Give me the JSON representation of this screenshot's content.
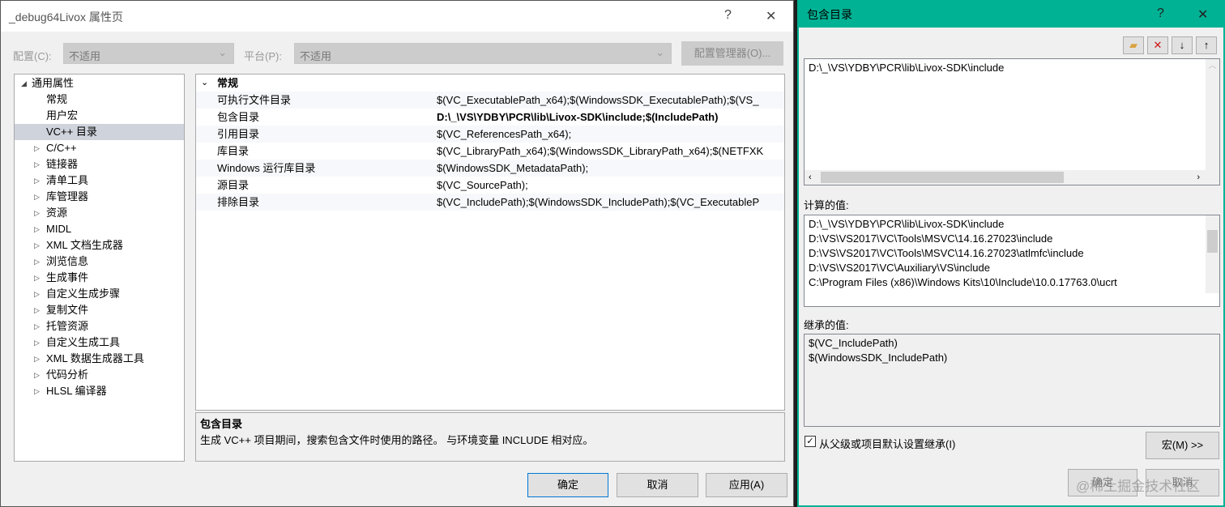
{
  "left_dialog": {
    "title": "_debug64Livox 属性页",
    "help": "?",
    "close": "✕",
    "config_label": "配置(C):",
    "config_value": "不适用",
    "platform_label": "平台(P):",
    "platform_value": "不适用",
    "config_manager": "配置管理器(O)...",
    "tree": [
      {
        "label": "通用属性",
        "arrow": "◢",
        "indent": 0
      },
      {
        "label": "常规",
        "arrow": "",
        "indent": 1
      },
      {
        "label": "用户宏",
        "arrow": "",
        "indent": 1
      },
      {
        "label": "VC++ 目录",
        "arrow": "",
        "indent": 1,
        "selected": true
      },
      {
        "label": "C/C++",
        "arrow": "▷",
        "indent": 1
      },
      {
        "label": "链接器",
        "arrow": "▷",
        "indent": 1
      },
      {
        "label": "清单工具",
        "arrow": "▷",
        "indent": 1
      },
      {
        "label": "库管理器",
        "arrow": "▷",
        "indent": 1
      },
      {
        "label": "资源",
        "arrow": "▷",
        "indent": 1
      },
      {
        "label": "MIDL",
        "arrow": "▷",
        "indent": 1
      },
      {
        "label": "XML 文档生成器",
        "arrow": "▷",
        "indent": 1
      },
      {
        "label": "浏览信息",
        "arrow": "▷",
        "indent": 1
      },
      {
        "label": "生成事件",
        "arrow": "▷",
        "indent": 1
      },
      {
        "label": "自定义生成步骤",
        "arrow": "▷",
        "indent": 1
      },
      {
        "label": "复制文件",
        "arrow": "▷",
        "indent": 1
      },
      {
        "label": "托管资源",
        "arrow": "▷",
        "indent": 1
      },
      {
        "label": "自定义生成工具",
        "arrow": "▷",
        "indent": 1
      },
      {
        "label": "XML 数据生成器工具",
        "arrow": "▷",
        "indent": 1
      },
      {
        "label": "代码分析",
        "arrow": "▷",
        "indent": 1
      },
      {
        "label": "HLSL 编译器",
        "arrow": "▷",
        "indent": 1
      }
    ],
    "grid_section": "常规",
    "grid": [
      {
        "key": "可执行文件目录",
        "value": "$(VC_ExecutablePath_x64);$(WindowsSDK_ExecutablePath);$(VS_"
      },
      {
        "key": "包含目录",
        "value": "D:\\_\\VS\\YDBY\\PCR\\lib\\Livox-SDK\\include;$(IncludePath)",
        "bold": true
      },
      {
        "key": "引用目录",
        "value": "$(VC_ReferencesPath_x64);"
      },
      {
        "key": "库目录",
        "value": "$(VC_LibraryPath_x64);$(WindowsSDK_LibraryPath_x64);$(NETFXK"
      },
      {
        "key": "Windows 运行库目录",
        "value": "$(WindowsSDK_MetadataPath);"
      },
      {
        "key": "源目录",
        "value": "$(VC_SourcePath);"
      },
      {
        "key": "排除目录",
        "value": "$(VC_IncludePath);$(WindowsSDK_IncludePath);$(VC_ExecutableP"
      }
    ],
    "desc_title": "包含目录",
    "desc_text": "生成 VC++ 项目期间，搜索包含文件时使用的路径。 与环境变量 INCLUDE 相对应。",
    "ok": "确定",
    "cancel": "取消",
    "apply": "应用(A)"
  },
  "right_dialog": {
    "title": "包含目录",
    "help": "?",
    "close": "✕",
    "edit_lines": [
      "D:\\_\\VS\\YDBY\\PCR\\lib\\Livox-SDK\\include"
    ],
    "computed_label": "计算的值:",
    "computed": [
      "D:\\_\\VS\\YDBY\\PCR\\lib\\Livox-SDK\\include",
      "D:\\VS\\VS2017\\VC\\Tools\\MSVC\\14.16.27023\\include",
      "D:\\VS\\VS2017\\VC\\Tools\\MSVC\\14.16.27023\\atlmfc\\include",
      "D:\\VS\\VS2017\\VC\\Auxiliary\\VS\\include",
      "C:\\Program Files (x86)\\Windows Kits\\10\\Include\\10.0.17763.0\\ucrt"
    ],
    "inherited_label": "继承的值:",
    "inherited": [
      "$(VC_IncludePath)",
      "$(WindowsSDK_IncludePath)"
    ],
    "inherit_checkbox": "从父级或项目默认设置继承(I)",
    "macros": "宏(M) >>",
    "ok": "确定",
    "cancel": "取消",
    "watermark": "@稀土掘金技术社区"
  },
  "colors": {
    "accent": "#00b294"
  }
}
